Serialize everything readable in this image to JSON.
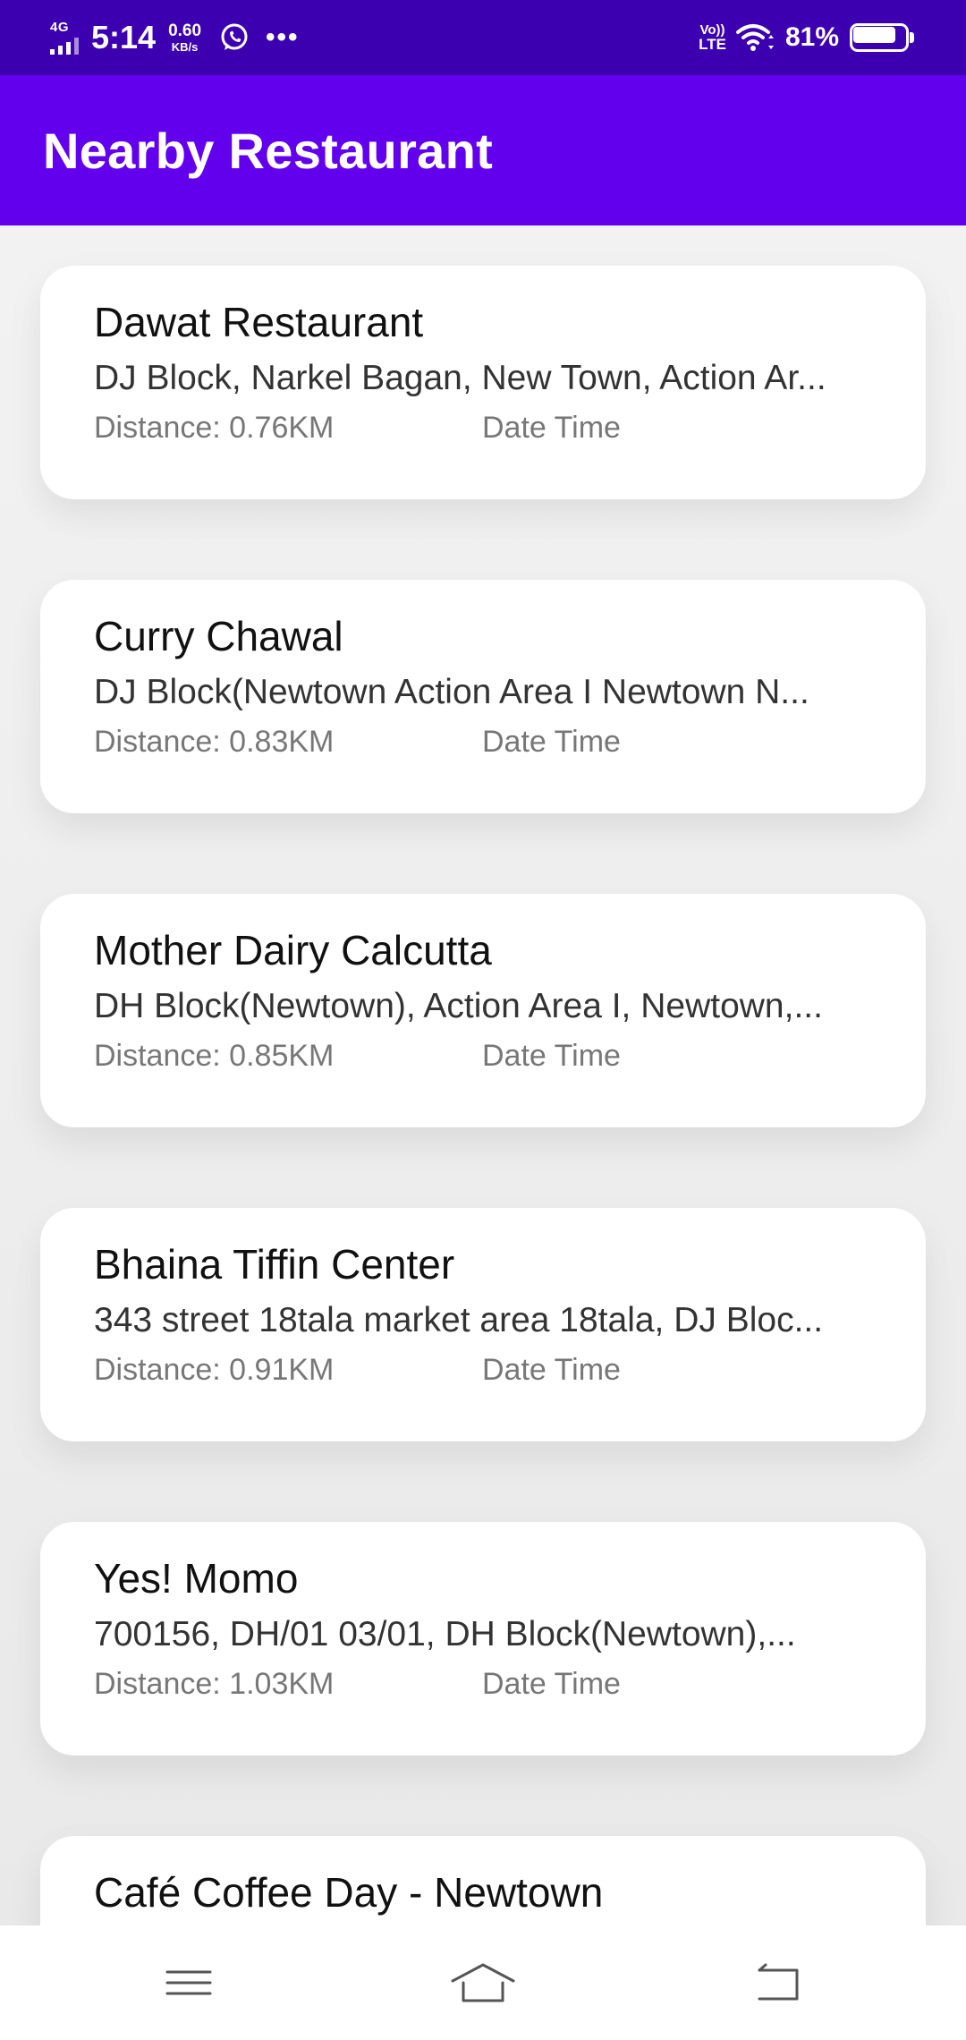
{
  "status_bar": {
    "signal_type": "4G",
    "time": "5:14",
    "net_speed_value": "0.60",
    "net_speed_unit": "KB/s",
    "volte_top": "Vo))",
    "volte_bottom": "LTE",
    "battery_percent": "81%",
    "battery_level": 0.81,
    "icons": [
      "signal-icon",
      "whatsapp-icon",
      "more-dots-icon",
      "wifi-icon",
      "battery-icon"
    ]
  },
  "app_bar": {
    "title": "Nearby Restaurant",
    "color": "#6200ee"
  },
  "restaurants": [
    {
      "name": "Dawat Restaurant",
      "address": "DJ Block, Narkel Bagan, New Town, Action Ar...",
      "distance": "Distance: 0.76KM",
      "date_time": "Date Time"
    },
    {
      "name": "Curry Chawal",
      "address": "DJ Block(Newtown Action Area I Newtown N...",
      "distance": "Distance: 0.83KM",
      "date_time": "Date Time"
    },
    {
      "name": "Mother Dairy Calcutta",
      "address": "DH Block(Newtown), Action Area I, Newtown,...",
      "distance": "Distance: 0.85KM",
      "date_time": "Date Time"
    },
    {
      "name": "Bhaina Tiffin Center",
      "address": "343 street 18tala market area 18tala, DJ Bloc...",
      "distance": "Distance: 0.91KM",
      "date_time": "Date Time"
    },
    {
      "name": "Yes! Momo",
      "address": "700156, DH/01 03/01, DH Block(Newtown),...",
      "distance": "Distance: 1.03KM",
      "date_time": "Date Time"
    },
    {
      "name": "Café Coffee Day - Newtown",
      "address": "",
      "distance": "",
      "date_time": ""
    }
  ],
  "nav_bar": {
    "icons": [
      "menu-icon",
      "home-icon",
      "back-icon"
    ]
  }
}
